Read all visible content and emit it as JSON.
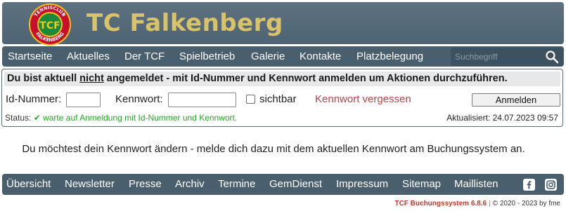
{
  "header": {
    "logo_text": "TENNISCLUB FALKENBERG",
    "logo_initials": "TCF",
    "title": "TC Falkenberg"
  },
  "nav": {
    "items": [
      "Startseite",
      "Aktuelles",
      "Der TCF",
      "Spielbetrieb",
      "Galerie",
      "Kontakte",
      "Platzbelegung"
    ],
    "search_placeholder": "Suchbegriff"
  },
  "login": {
    "heading_pre": "Du bist aktuell ",
    "heading_em": "nicht",
    "heading_post": " angemeldet - mit Id-Nummer und Kennwort anmelden um Aktionen durchzuführen.",
    "id_label": "Id-Nummer:",
    "id_value": "",
    "password_label": "Kennwort:",
    "password_value": "",
    "show_label": "sichtbar",
    "show_checked": false,
    "forgot_label": "Kennwort vergessen",
    "button_label": "Anmelden",
    "status_label": "Status:",
    "status_text": "✔ warte auf Anmeldung mit Id-Nummer und Kennwort.",
    "updated_label": "Aktualisiert: 24.07.2023 09:57"
  },
  "message": "Du möchtest dein Kennwort ändern - melde dich dazu mit dem aktuellen Kennwort am Buchungssystem an.",
  "footer": {
    "items": [
      "Übersicht",
      "Newsletter",
      "Presse",
      "Archiv",
      "Termine",
      "GemDienst",
      "Impressum",
      "Sitemap",
      "Maillisten"
    ],
    "social_icons": [
      "facebook-icon",
      "instagram-icon"
    ],
    "brand": "TCF Buchungssystem 6.8.6",
    "copyright": "© 2020 - 2023 by fme"
  },
  "colors": {
    "header_bg": "#56697a",
    "nav_bg": "#4a5f6e",
    "title_gold": "#d8c26a",
    "link_red": "#c0424a",
    "status_green": "#28a828"
  }
}
